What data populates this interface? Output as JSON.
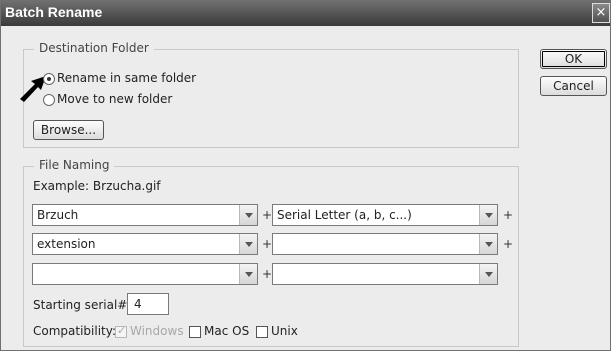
{
  "window": {
    "title": "Batch Rename",
    "close_icon": "×"
  },
  "destination": {
    "legend": "Destination Folder",
    "option_same": "Rename in same folder",
    "option_new": "Move to new folder",
    "selected": "same",
    "browse_label": "Browse..."
  },
  "buttons": {
    "ok": "OK",
    "cancel": "Cancel"
  },
  "naming": {
    "legend": "File Naming",
    "example": "Example: Brzucha.gif",
    "rows": [
      {
        "left": "Brzuch",
        "right": "Serial Letter (a, b, c...)"
      },
      {
        "left": "extension",
        "right": ""
      },
      {
        "left": "",
        "right": ""
      }
    ],
    "plus": "+",
    "serial_label": "Starting serial#:",
    "serial_value": "4"
  },
  "compat": {
    "label": "Compatibility:",
    "windows": "Windows",
    "mac": "Mac OS",
    "unix": "Unix",
    "windows_checked": true,
    "mac_checked": false,
    "unix_checked": false
  }
}
